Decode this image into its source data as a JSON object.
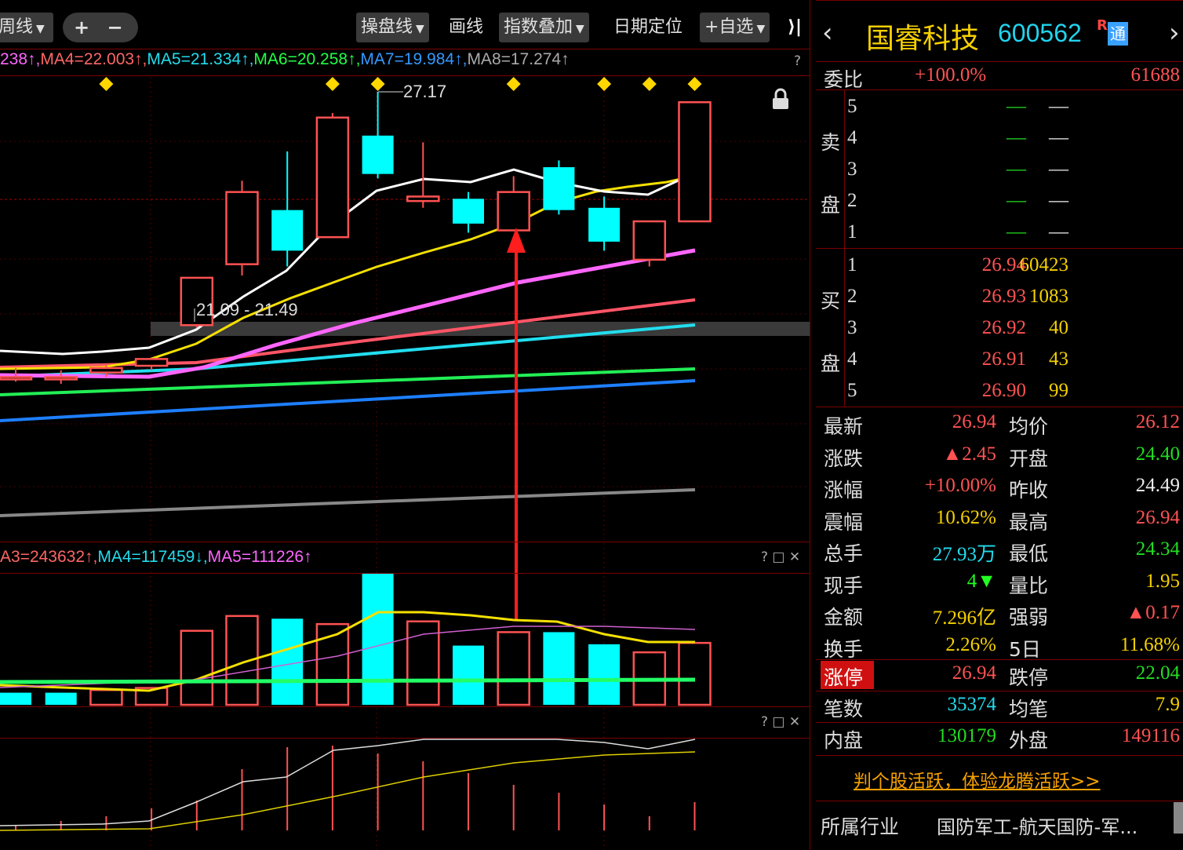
{
  "toolbar": {
    "period_label": "周线",
    "zoom_plus": "+",
    "zoom_minus": "−",
    "op_line": "操盘线",
    "draw": "画线",
    "index_overlay": "指数叠加",
    "date_locate": "日期定位",
    "add_watch": "+自选",
    "collapse": "⟩|"
  },
  "price_ma": {
    "items": [
      {
        "text": "238↑,",
        "color": "#ff66ff"
      },
      {
        "text": "MA4=22.003↑,",
        "color": "#ff6666"
      },
      {
        "text": "MA5=21.334↑,",
        "color": "#22ddee"
      },
      {
        "text": "MA6=20.258↑,",
        "color": "#22ff44"
      },
      {
        "text": "MA7=19.984↑,",
        "color": "#3399ff"
      },
      {
        "text": "MA8=17.274↑",
        "color": "#aaaaaa"
      }
    ],
    "help": "?"
  },
  "annotations": {
    "high_label": "27.17",
    "range_label": "21.09 - 21.49"
  },
  "volume_ma": {
    "items": [
      {
        "text": "A3=243632↑,",
        "color": "#ff6666"
      },
      {
        "text": "MA4=117459↓,",
        "color": "#22ddee"
      },
      {
        "text": "MA5=111226↑",
        "color": "#ff66ff"
      }
    ]
  },
  "panel_ctrls": "? □ ✕",
  "stock": {
    "name": "国睿科技",
    "code": "600562",
    "badge_r": "R",
    "badge_tong": "通",
    "prev": "‹",
    "next": "›"
  },
  "weibi": {
    "label": "委比",
    "pct": "+100.0%",
    "diff": "61688"
  },
  "sell": {
    "label_top": "卖",
    "label_bot": "盘",
    "rows": [
      {
        "level": "5",
        "price": "—",
        "vol": "—"
      },
      {
        "level": "4",
        "price": "—",
        "vol": "—"
      },
      {
        "level": "3",
        "price": "—",
        "vol": "—"
      },
      {
        "level": "2",
        "price": "—",
        "vol": "—"
      },
      {
        "level": "1",
        "price": "—",
        "vol": "—"
      }
    ]
  },
  "buy": {
    "label_top": "买",
    "label_bot": "盘",
    "rows": [
      {
        "level": "1",
        "price": "26.94",
        "vol": "60423"
      },
      {
        "level": "2",
        "price": "26.93",
        "vol": "1083"
      },
      {
        "level": "3",
        "price": "26.92",
        "vol": "40"
      },
      {
        "level": "4",
        "price": "26.91",
        "vol": "43"
      },
      {
        "level": "5",
        "price": "26.90",
        "vol": "99"
      }
    ]
  },
  "quote": [
    {
      "l1": "最新",
      "v1": "26.94",
      "c1": "red",
      "l2": "均价",
      "v2": "26.12",
      "c2": "red"
    },
    {
      "l1": "涨跌",
      "v1": "▲2.45",
      "c1": "red",
      "l2": "开盘",
      "v2": "24.40",
      "c2": "green"
    },
    {
      "l1": "涨幅",
      "v1": "+10.00%",
      "c1": "red",
      "l2": "昨收",
      "v2": "24.49",
      "c2": "white"
    },
    {
      "l1": "震幅",
      "v1": "10.62%",
      "c1": "yellow",
      "l2": "最高",
      "v2": "26.94",
      "c2": "red"
    },
    {
      "l1": "总手",
      "v1": "27.93万",
      "c1": "cyan",
      "l2": "最低",
      "v2": "24.34",
      "c2": "green"
    },
    {
      "l1": "现手",
      "v1": "4▼",
      "c1": "lgreen",
      "l2": "量比",
      "v2": "1.95",
      "c2": "yellow"
    },
    {
      "l1": "金额",
      "v1": "7.296亿",
      "c1": "yellow",
      "l2": "强弱",
      "v2": "▲0.17",
      "c2": "red"
    },
    {
      "l1": "换手",
      "v1": "2.26%",
      "c1": "yellow",
      "l2": "5日",
      "v2": "11.68%",
      "c2": "yellow"
    }
  ],
  "limit": {
    "up_label": "涨停",
    "up_val": "26.94",
    "down_label": "跌停",
    "down_val": "22.04"
  },
  "trades": {
    "l1": "笔数",
    "v1": "35374",
    "l2": "均笔",
    "v2": "7.9"
  },
  "inout": {
    "l1": "内盘",
    "v1": "130179",
    "l2": "外盘",
    "v2": "149116"
  },
  "promo_link": "判个股活跃，体验龙腾活跃>>",
  "industry": {
    "label": "所属行业",
    "value": "国防军工-航天国防-军..."
  },
  "colors": {
    "up": "#ff5252",
    "down": "#00ffff",
    "grid": "#7a0000"
  },
  "chart_data": {
    "type": "candlestick",
    "candles": [
      {
        "o": 20.85,
        "h": 21.05,
        "l": 20.75,
        "c": 20.85
      },
      {
        "o": 20.85,
        "h": 21.0,
        "l": 20.7,
        "c": 20.85
      },
      {
        "o": 20.95,
        "h": 21.15,
        "l": 20.85,
        "c": 21.05
      },
      {
        "o": 21.1,
        "h": 21.2,
        "l": 21.0,
        "c": 21.25
      },
      {
        "o": 22.0,
        "h": 23.05,
        "l": 21.95,
        "c": 23.05
      },
      {
        "o": 23.35,
        "h": 25.2,
        "l": 23.1,
        "c": 24.95
      },
      {
        "o": 24.55,
        "h": 25.85,
        "l": 23.3,
        "c": 23.65
      },
      {
        "o": 23.95,
        "h": 26.7,
        "l": 23.95,
        "c": 26.6
      },
      {
        "o": 26.2,
        "h": 27.17,
        "l": 25.25,
        "c": 25.35
      },
      {
        "o": 24.75,
        "h": 26.05,
        "l": 24.6,
        "c": 24.85
      },
      {
        "o": 24.8,
        "h": 24.95,
        "l": 24.05,
        "c": 24.25
      },
      {
        "o": 24.1,
        "h": 25.3,
        "l": 24.1,
        "c": 24.95
      },
      {
        "o": 25.5,
        "h": 25.65,
        "l": 24.45,
        "c": 24.55
      },
      {
        "o": 24.6,
        "h": 24.85,
        "l": 23.65,
        "c": 23.85
      },
      {
        "o": 23.45,
        "h": 24.3,
        "l": 23.3,
        "c": 24.3
      },
      {
        "o": 24.3,
        "h": 26.94,
        "l": 24.3,
        "c": 26.94
      }
    ],
    "volume": [
      {
        "v": 18,
        "up": false
      },
      {
        "v": 18,
        "up": false
      },
      {
        "v": 22,
        "up": true
      },
      {
        "v": 25,
        "up": true
      },
      {
        "v": 110,
        "up": true
      },
      {
        "v": 132,
        "up": true
      },
      {
        "v": 128,
        "up": false
      },
      {
        "v": 120,
        "up": true
      },
      {
        "v": 196,
        "up": false
      },
      {
        "v": 124,
        "up": true
      },
      {
        "v": 88,
        "up": false
      },
      {
        "v": 108,
        "up": true
      },
      {
        "v": 108,
        "up": false
      },
      {
        "v": 90,
        "up": false
      },
      {
        "v": 78,
        "up": true
      },
      {
        "v": 92,
        "up": true
      }
    ],
    "buy_signal_indices": [
      2,
      7,
      8,
      11,
      13,
      14,
      15
    ]
  }
}
